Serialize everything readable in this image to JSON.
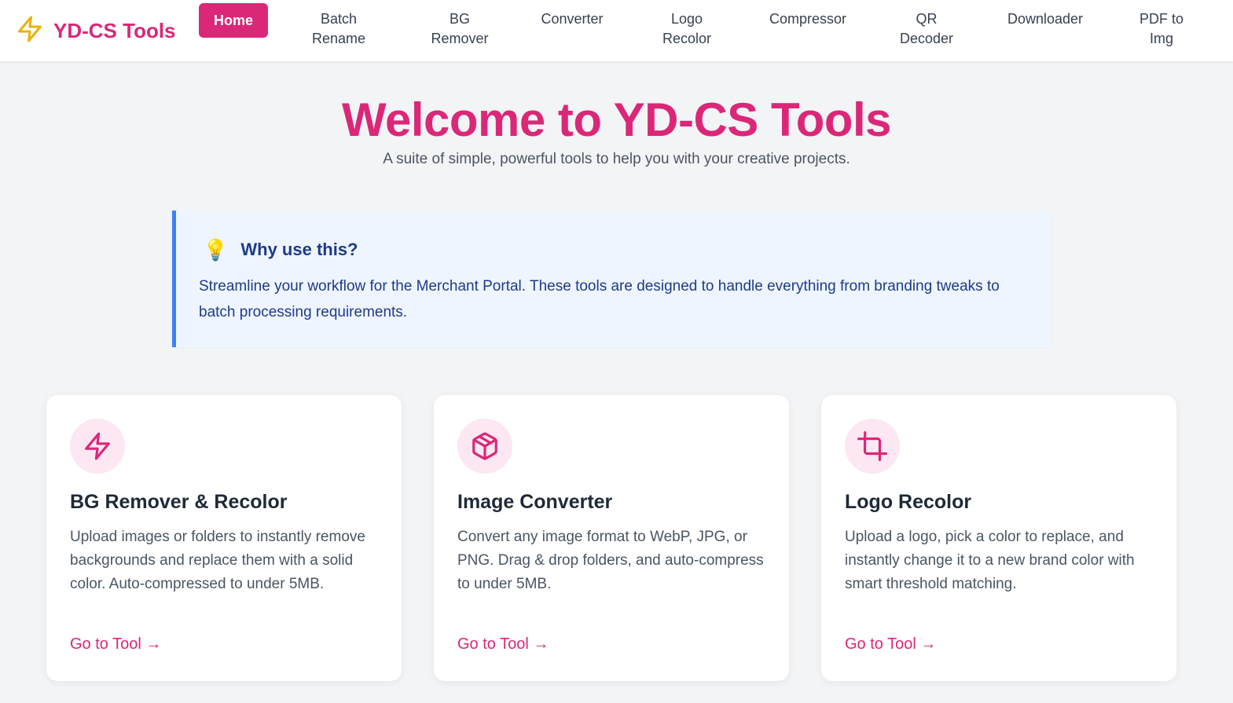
{
  "app": {
    "brand": "YD-CS Tools",
    "accent_color": "#db2777",
    "brand_icon": "lightning-icon"
  },
  "nav": {
    "items": [
      {
        "label": "Home",
        "active": true
      },
      {
        "label": "Batch Rename"
      },
      {
        "label": "BG Remover"
      },
      {
        "label": "Converter"
      },
      {
        "label": "Logo Recolor"
      },
      {
        "label": "Compressor"
      },
      {
        "label": "QR Decoder"
      },
      {
        "label": "Downloader"
      },
      {
        "label": "PDF to Img"
      }
    ]
  },
  "hero": {
    "title": "Welcome to YD-CS Tools",
    "subtitle": "A suite of simple, powerful tools to help you with your creative projects."
  },
  "info": {
    "icon": "lightbulb-icon",
    "title": "Why use this?",
    "body": "Streamline your workflow for the Merchant Portal. These tools are designed to handle everything from branding tweaks to batch processing requirements."
  },
  "cards": [
    {
      "icon": "lightning-icon",
      "title": "BG Remover & Recolor",
      "description": "Upload images or folders to instantly remove backgrounds and replace them with a solid color. Auto-compressed to under 5MB.",
      "link": "Go to Tool →"
    },
    {
      "icon": "box-icon",
      "title": "Image Converter",
      "description": "Convert any image format to WebP, JPG, or PNG. Drag & drop folders, and auto-compress to under 5MB.",
      "link": "Go to Tool →"
    },
    {
      "icon": "crop-icon",
      "title": "Logo Recolor",
      "description": "Upload a logo, pick a color to replace, and instantly change it to a new brand color with smart threshold matching.",
      "link": "Go to Tool →"
    }
  ]
}
